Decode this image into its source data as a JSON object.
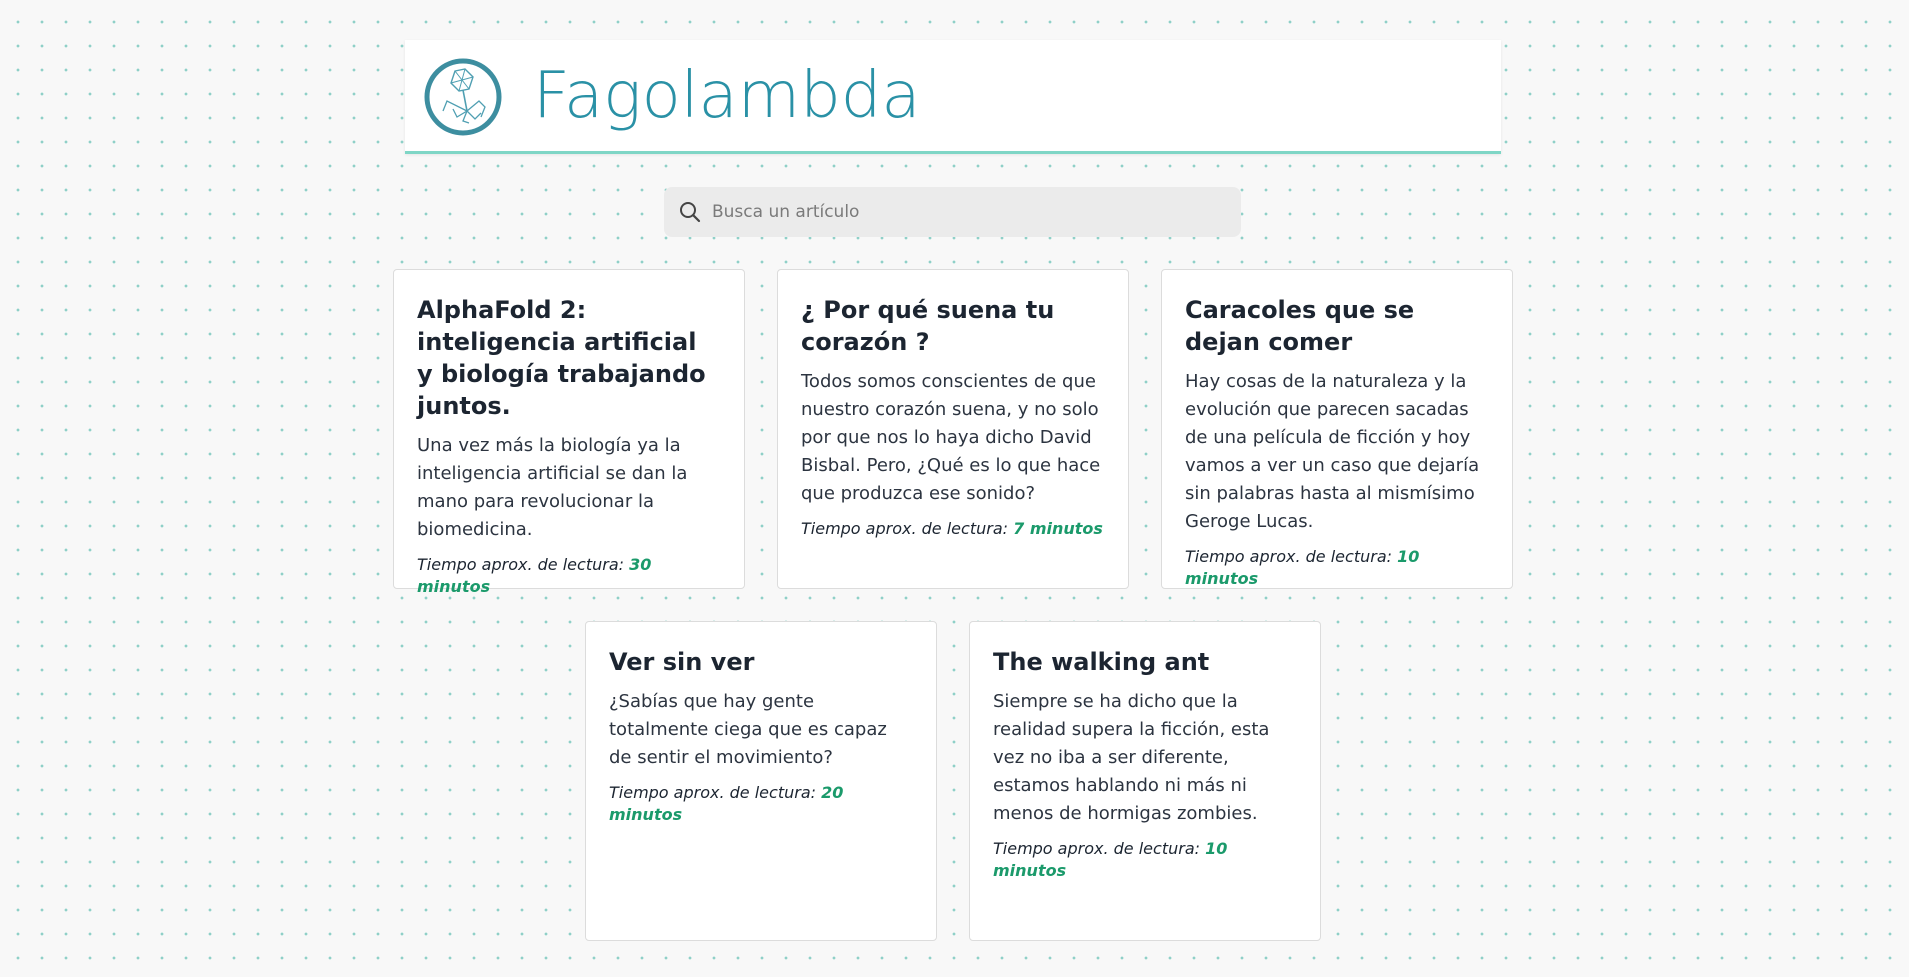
{
  "site": {
    "title": "Fagolambda",
    "logo_icon": "phage-logo-icon",
    "accent_color": "#2a91a6",
    "highlight_color": "#1b9a6b"
  },
  "search": {
    "placeholder": "Busca un artículo",
    "value": ""
  },
  "reading_label": "Tiempo aprox. de lectura:",
  "articles": [
    {
      "title": "AlphaFold 2: inteligencia artificial y biología trabajando juntos.",
      "description": "Una vez más la biología ya la inteligencia artificial se dan la mano para revolucionar la biomedicina.",
      "reading_time": "30 minutos"
    },
    {
      "title": "¿ Por qué suena tu corazón ?",
      "description": "Todos somos conscientes de que nuestro corazón suena, y no solo por que nos lo haya dicho David Bisbal. Pero, ¿Qué es lo que hace que produzca ese sonido?",
      "reading_time": "7 minutos"
    },
    {
      "title": "Caracoles que se dejan comer",
      "description": "Hay cosas de la naturaleza y la evolución que parecen sacadas de una película de ficción y hoy vamos a ver un caso que dejaría sin palabras hasta al mismísimo Geroge Lucas.",
      "reading_time": "10 minutos"
    },
    {
      "title": "Ver sin ver",
      "description": "¿Sabías que hay gente totalmente ciega que es capaz de sentir el movimiento?",
      "reading_time": "20 minutos"
    },
    {
      "title": "The walking ant",
      "description": "Siempre se ha dicho que la realidad supera la ficción, esta vez no iba a ser diferente, estamos hablando ni más ni menos de hormigas zombies.",
      "reading_time": "10 minutos"
    }
  ]
}
